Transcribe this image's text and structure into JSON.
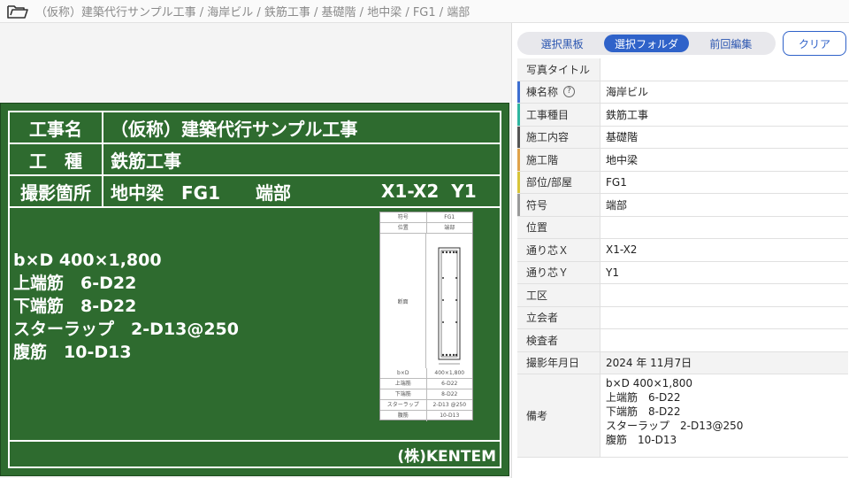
{
  "breadcrumb": "（仮称）建築代行サンプル工事 / 海岸ビル / 鉄筋工事 / 基礎階 / 地中梁 / FG1 / 端部",
  "board": {
    "rows": [
      {
        "label": "工事名",
        "value": "（仮称）建築代行サンプル工事"
      },
      {
        "label": "工　種",
        "value": "鉄筋工事"
      },
      {
        "label": "撮影箇所",
        "value_a": "地中梁　FG1　　端部",
        "value_b": "X1-X2  Y1"
      }
    ],
    "notes": "b×D 400×1,800\n上端筋　6-D22\n下端筋　8-D22\nスターラップ　2-D13@250\n腹筋　10-D13",
    "brand": "(株)KENTEM",
    "sheet": {
      "top": [
        [
          "符号",
          "FG1"
        ],
        [
          "位置",
          "端部"
        ]
      ],
      "mid_label": "断面",
      "bottom": [
        [
          "b×D",
          "400×1,800"
        ],
        [
          "上端筋",
          "6-D22"
        ],
        [
          "下端筋",
          "8-D22"
        ],
        [
          "スターラップ",
          "2-D13 @250"
        ],
        [
          "腹筋",
          "10-D13"
        ]
      ]
    }
  },
  "panel": {
    "tabs": [
      "選択黒板",
      "選択フォルダ",
      "前回編集"
    ],
    "active_tab": 1,
    "clear_label": "クリア",
    "rows": [
      {
        "label": "写真タイトル",
        "value": "",
        "color": ""
      },
      {
        "label": "棟名称",
        "value": "海岸ビル",
        "color": "#3d6fd1",
        "help": true
      },
      {
        "label": "工事種目",
        "value": "鉄筋工事",
        "color": "#2fb5a0"
      },
      {
        "label": "施工内容",
        "value": "基礎階",
        "color": "#555555"
      },
      {
        "label": "施工階",
        "value": "地中梁",
        "color": "#e0a24a"
      },
      {
        "label": "部位/部屋",
        "value": "FG1",
        "color": "#d8c43a"
      },
      {
        "label": "符号",
        "value": "端部",
        "color": "#9a9a9a"
      },
      {
        "label": "位置",
        "value": "",
        "color": ""
      },
      {
        "label": "通り芯Ｘ",
        "value": "X1-X2",
        "color": ""
      },
      {
        "label": "通り芯Ｙ",
        "value": "Y1",
        "color": ""
      },
      {
        "label": "工区",
        "value": "",
        "color": ""
      },
      {
        "label": "立会者",
        "value": "",
        "color": ""
      },
      {
        "label": "検査者",
        "value": "",
        "color": ""
      },
      {
        "label": "撮影年月日",
        "value": "2024 年 11月7日",
        "color": "",
        "grey": true
      }
    ],
    "remarks_label": "備考",
    "remarks": "b×D 400×1,800\n上端筋　6-D22\n下端筋　8-D22\nスターラップ　2-D13@250\n腹筋　10-D13"
  },
  "colors": {
    "board": "#2e6b2f",
    "accent": "#2f62c9"
  }
}
